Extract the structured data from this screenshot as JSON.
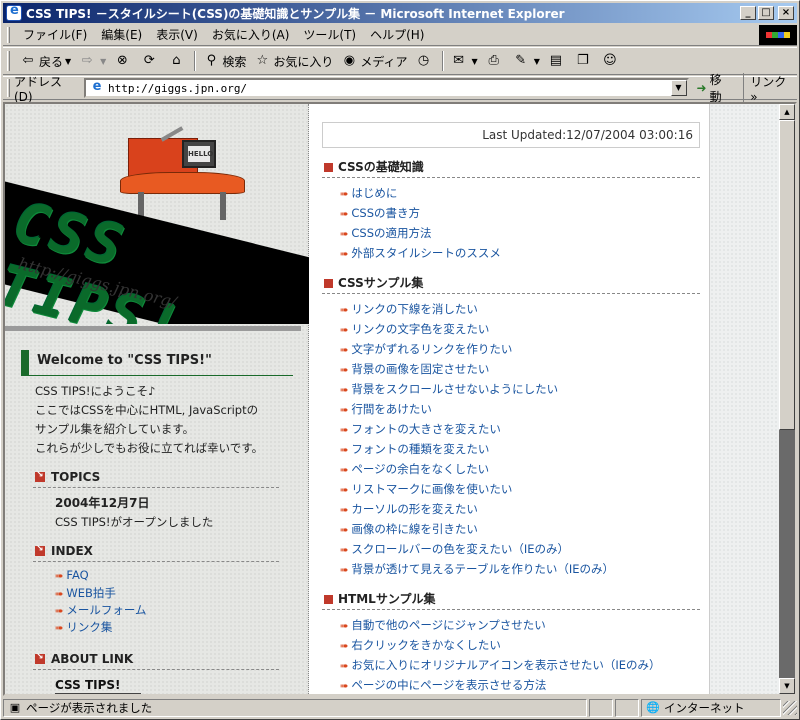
{
  "window": {
    "title": "CSS TIPS! －スタイルシート(CSS)の基礎知識とサンプル集 － Microsoft Internet Explorer",
    "min_label": "_",
    "max_label": "□",
    "close_label": "×"
  },
  "menu": [
    "ファイル(F)",
    "編集(E)",
    "表示(V)",
    "お気に入り(A)",
    "ツール(T)",
    "ヘルプ(H)"
  ],
  "toolbar": {
    "back": "戻る",
    "search": "検索",
    "favorites": "お気に入り",
    "media": "メディア"
  },
  "address": {
    "label": "アドレス(D)",
    "url": "http://giggs.jpn.org/",
    "go": "移動",
    "links": "リンク"
  },
  "logo": {
    "title": "CSS TIPS!",
    "url": "http://giggs.jpn.org/",
    "monitor_text": "HELLO"
  },
  "left": {
    "welcome": "Welcome to \"CSS TIPS!\"",
    "intro": [
      "CSS TIPS!にようこそ♪",
      "ここではCSSを中心にHTML, JavaScriptの",
      "サンプル集を紹介しています。",
      "これらが少しでもお役に立てれば幸いです。"
    ],
    "topics_heading": "TOPICS",
    "topics_date": "2004年12月7日",
    "topics_text": "CSS TIPS!がオープンしました",
    "index_heading": "INDEX",
    "index_items": [
      "FAQ",
      "WEB拍手",
      "メールフォーム",
      "リンク集"
    ],
    "about_heading": "ABOUT LINK",
    "about_sub": "CSS TIPS!"
  },
  "right": {
    "last_updated": "Last Updated:12/07/2004 03:00:16",
    "sections": [
      {
        "heading": "CSSの基礎知識",
        "items": [
          "はじめに",
          "CSSの書き方",
          "CSSの適用方法",
          "外部スタイルシートのススメ"
        ]
      },
      {
        "heading": "CSSサンプル集",
        "items": [
          "リンクの下線を消したい",
          "リンクの文字色を変えたい",
          "文字がずれるリンクを作りたい",
          "背景の画像を固定させたい",
          "背景をスクロールさせないようにしたい",
          "行間をあけたい",
          "フォントの大きさを変えたい",
          "フォントの種類を変えたい",
          "ページの余白をなくしたい",
          "リストマークに画像を使いたい",
          "カーソルの形を変えたい",
          "画像の枠に線を引きたい",
          "スクロールバーの色を変えたい（IEのみ）",
          "背景が透けて見えるテーブルを作りたい（IEのみ）"
        ]
      },
      {
        "heading": "HTMLサンプル集",
        "items": [
          "自動で他のページにジャンプさせたい",
          "右クリックをきかなくしたい",
          "お気に入りにオリジナルアイコンを表示させたい（IEのみ）",
          "ページの中にページを表示させる方法"
        ]
      }
    ]
  },
  "status": {
    "text": "ページが表示されました",
    "zone": "インターネット"
  }
}
